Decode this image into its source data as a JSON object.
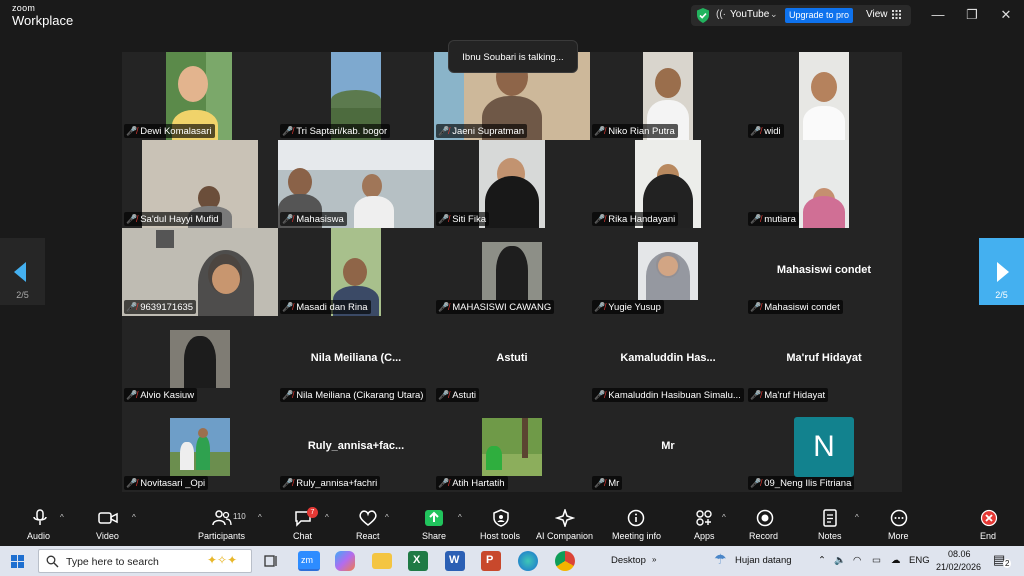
{
  "app": {
    "logo_top": "zoom",
    "logo_bottom": "Workplace",
    "stream_label": "YouTube",
    "upgrade_label": "Upgrade to pro",
    "view_label": "View"
  },
  "talking_indicator": "Ibnu Soubari is talking...",
  "pagination": {
    "left": "2/5",
    "right": "2/5"
  },
  "tiles": [
    {
      "name": "Dewi Komalasari"
    },
    {
      "name": "Tri Saptari/kab. bogor"
    },
    {
      "name": "Jaeni Supratman"
    },
    {
      "name": "Niko Rian Putra"
    },
    {
      "name": "widi"
    },
    {
      "name": "Sa'dul Hayyi Mufid"
    },
    {
      "name": "Mahasiswa"
    },
    {
      "name": "Siti Fika"
    },
    {
      "name": "Rika Handayani"
    },
    {
      "name": "mutiara"
    },
    {
      "name": "9639171635"
    },
    {
      "name": "Masadi dan Rina"
    },
    {
      "name": "MAHASISWI CAWANG"
    },
    {
      "name": "Yugie Yusup"
    },
    {
      "name": "Mahasiswi condet",
      "display": "Mahasiswi condet"
    },
    {
      "name": "Alvio Kasiuw"
    },
    {
      "name": "Nila Meiliana (Cikarang Utara)",
      "display": "Nila  Meiliana  (C..."
    },
    {
      "name": "Astuti",
      "display": "Astuti"
    },
    {
      "name": "Kamaluddin Hasibuan Simalu...",
      "display": "Kamaluddin  Has..."
    },
    {
      "name": "Ma'ruf Hidayat",
      "display": "Ma'ruf Hidayat"
    },
    {
      "name": "Novitasari _Opi"
    },
    {
      "name": "Ruly_annisa+fachri",
      "display": "Ruly_annisa+fac..."
    },
    {
      "name": "Atih Hartatih"
    },
    {
      "name": "Mr",
      "display": "Mr"
    },
    {
      "name": "09_Neng Ilis Fitriana",
      "avatar": "N"
    }
  ],
  "toolbar": {
    "audio": "Audio",
    "video": "Video",
    "participants": "Participants",
    "participants_count": "110",
    "chat": "Chat",
    "chat_badge": "7",
    "react": "React",
    "share": "Share",
    "host_tools": "Host tools",
    "ai_companion": "AI Companion",
    "meeting_info": "Meeting info",
    "apps": "Apps",
    "record": "Record",
    "notes": "Notes",
    "more": "More",
    "end": "End"
  },
  "taskbar": {
    "search_placeholder": "Type here to search",
    "desktop": "Desktop",
    "weather": "Hujan datang",
    "lang": "ENG",
    "time": "08.06",
    "date": "21/02/2026",
    "notif_count": "2"
  },
  "colors": {
    "accent": "#0e72ed",
    "share_green": "#21c45d",
    "muted_red": "#e53935",
    "avatar_teal": "#12828e"
  }
}
